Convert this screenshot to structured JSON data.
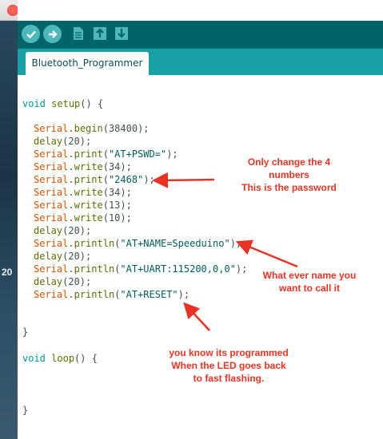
{
  "desktop": {
    "partial_text": "20"
  },
  "window": {
    "traffic_lights": [
      "close",
      "minimize",
      "maximize"
    ]
  },
  "toolbar": {
    "buttons": [
      {
        "name": "verify",
        "icon": "check-icon"
      },
      {
        "name": "upload",
        "icon": "arrow-right-icon"
      },
      {
        "name": "new",
        "icon": "new-file-icon"
      },
      {
        "name": "open",
        "icon": "open-arrow-up-icon"
      },
      {
        "name": "save",
        "icon": "save-arrow-down-icon"
      }
    ]
  },
  "tabs": [
    {
      "label": "Bluetooth_Programmer"
    }
  ],
  "code": {
    "l1_type": "void",
    "l1_fn": "setup",
    "l1_rest": "() {",
    "l2_obj": "Serial",
    "l2_fn": "begin",
    "l2_rest": "(38400);",
    "l3_fn": "delay",
    "l3_rest": "(20);",
    "l4_obj": "Serial",
    "l4_fn": "print",
    "l4_str": "\"AT+PSWD=\"",
    "l4_end": ");",
    "l5_obj": "Serial",
    "l5_fn": "write",
    "l5_rest": "(34);",
    "l6_obj": "Serial",
    "l6_fn": "print",
    "l6_str": "\"2468\"",
    "l6_end": ");",
    "l7_obj": "Serial",
    "l7_fn": "write",
    "l7_rest": "(34);",
    "l8_obj": "Serial",
    "l8_fn": "write",
    "l8_rest": "(13);",
    "l9_obj": "Serial",
    "l9_fn": "write",
    "l9_rest": "(10);",
    "l10_fn": "delay",
    "l10_rest": "(20);",
    "l11_obj": "Serial",
    "l11_fn": "println",
    "l11_str": "\"AT+NAME=Speeduino\"",
    "l11_end": ");",
    "l12_fn": "delay",
    "l12_rest": "(20);",
    "l13_obj": "Serial",
    "l13_fn": "println",
    "l13_str": "\"AT+UART:115200,0,0\"",
    "l13_end": ");",
    "l14_fn": "delay",
    "l14_rest": "(20);",
    "l15_obj": "Serial",
    "l15_fn": "println",
    "l15_str": "\"AT+RESET\"",
    "l15_end": ");",
    "close_brace_1": "}",
    "loop_type": "void",
    "loop_fn": "loop",
    "loop_rest": "() {",
    "close_brace_2": "}"
  },
  "annotations": {
    "password_note_1": "Only change the 4",
    "password_note_2": "numbers",
    "password_note_3": "This is the password",
    "name_note_1": "What ever name you",
    "name_note_2": "want to call it",
    "reset_note_1": "you know its programmed",
    "reset_note_2": "When the LED goes back",
    "reset_note_3": "to fast flashing."
  },
  "colors": {
    "toolbar_bg": "#006468",
    "tabbar_bg": "#17a1a5",
    "annotation_red": "#ea3323"
  }
}
